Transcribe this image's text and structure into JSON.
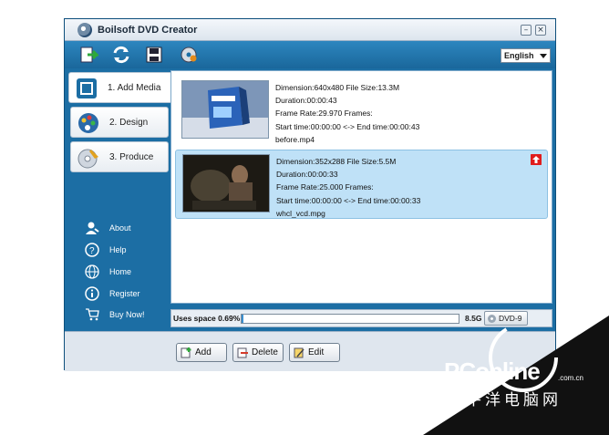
{
  "window": {
    "title": "Boilsoft DVD Creator",
    "minimize_glyph": "–",
    "close_glyph": "×"
  },
  "toolbar": {
    "buttons": [
      "add-file-icon",
      "convert-icon",
      "save-icon",
      "burn-disc-icon"
    ],
    "language": "English"
  },
  "sidebar": {
    "steps": [
      {
        "label": "1. Add Media",
        "icon": "film-icon"
      },
      {
        "label": "2. Design",
        "icon": "palette-icon"
      },
      {
        "label": "3. Produce",
        "icon": "disc-icon"
      }
    ],
    "links": [
      {
        "label": "About",
        "icon": "user-icon"
      },
      {
        "label": "Help",
        "icon": "help-icon"
      },
      {
        "label": "Home",
        "icon": "globe-icon"
      },
      {
        "label": "Register",
        "icon": "info-icon"
      },
      {
        "label": "Buy Now!",
        "icon": "cart-icon"
      }
    ]
  },
  "media": [
    {
      "dimension": "Dimension:640x480  File Size:13.3M",
      "duration": "Duration:00:00:43",
      "frame_rate": "Frame Rate:29.970  Frames:",
      "time": "Start time:00:00:00 <-> End time:00:00:43",
      "filename": "before.mp4"
    },
    {
      "dimension": "Dimension:352x288  File Size:5.5M",
      "duration": "Duration:00:00:33",
      "frame_rate": "Frame Rate:25.000  Frames:",
      "time": "Start time:00:00:00 <-> End time:00:00:33",
      "filename": "whcl_vcd.mpg"
    }
  ],
  "status": {
    "label": "Uses space 0.69%",
    "used_fraction": 0.0069,
    "capacity": "8.5G",
    "disc_type": "DVD-9"
  },
  "actions": {
    "add": "Add",
    "delete": "Delete",
    "edit": "Edit"
  },
  "watermark": {
    "brand": "PConline",
    "domain": ".com.cn",
    "chinese": "太平洋电脑网"
  }
}
